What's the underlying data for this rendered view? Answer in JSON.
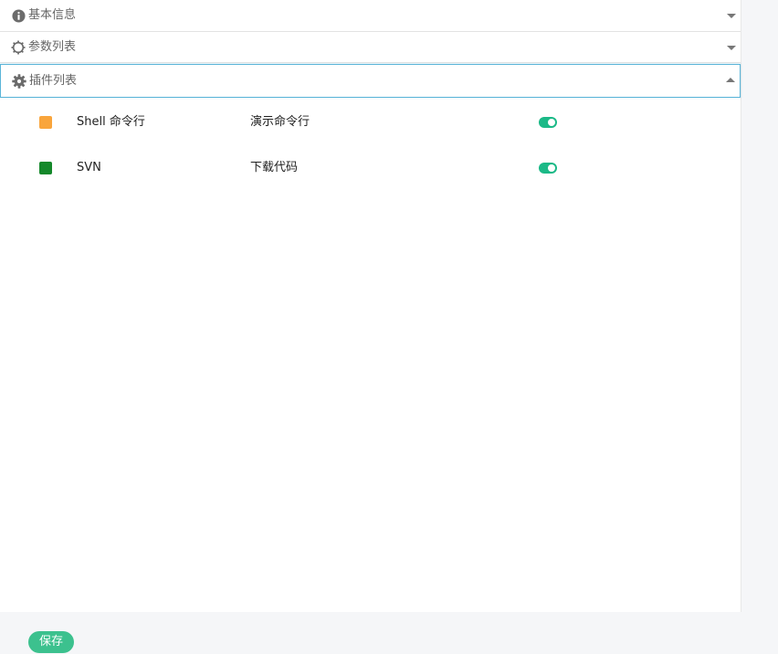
{
  "sections": [
    {
      "title": "基本信息",
      "icon": "info-circle-icon",
      "expanded": false
    },
    {
      "title": "参数列表",
      "icon": "gear-outline-icon",
      "expanded": false
    },
    {
      "title": "插件列表",
      "icon": "gear-icon",
      "expanded": true
    }
  ],
  "plugins": [
    {
      "name": "Shell 命令行",
      "description": "演示命令行",
      "color": "#f9a53c",
      "enabled": true
    },
    {
      "name": "SVN",
      "description": "下载代码",
      "color": "#14882a",
      "enabled": true
    }
  ],
  "footer": {
    "save_label": "保存"
  },
  "colors": {
    "accent": "#3cc18e",
    "toggle_on": "#1bb987",
    "active_border": "#5ab4d8"
  }
}
